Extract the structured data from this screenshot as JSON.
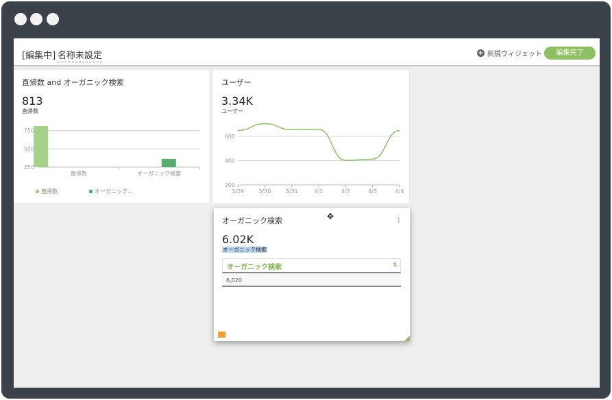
{
  "toolbar": {
    "mode_label": "[編集中]",
    "dashboard_title": "名称未設定",
    "new_widget_label": "新規ウィジェット",
    "done_label": "編集完了"
  },
  "widgets": [
    {
      "title": "直帰数 and オーガニック検索",
      "value": "813",
      "value_label": "直帰数",
      "legend": [
        "直帰数",
        "オーガニック..."
      ]
    },
    {
      "title": "ユーザー",
      "value": "3.34K",
      "value_label": "ユーザー"
    },
    {
      "title": "オーガニック検索",
      "value": "6.02K",
      "value_label": "オーガニック検索",
      "table": {
        "header": "オーガニック検索",
        "rows": [
          "6,020"
        ]
      }
    }
  ],
  "chart_data": [
    {
      "type": "bar",
      "categories": [
        "直帰数",
        "オーガニック検索"
      ],
      "series": [
        {
          "name": "直帰数",
          "values": [
            813,
            null
          ]
        },
        {
          "name": "オーガニック...",
          "values": [
            null,
            364
          ]
        }
      ],
      "yticks": [
        250,
        500,
        750
      ],
      "ylim": [
        250,
        813
      ],
      "colors": [
        "#a6d18a",
        "#5aad6c"
      ]
    },
    {
      "type": "line",
      "x": [
        "3/29",
        "3/30",
        "3/31",
        "4/1",
        "4/2",
        "4/3",
        "4/4"
      ],
      "values": [
        648,
        704,
        654,
        657,
        402,
        412,
        648
      ],
      "yticks": [
        200,
        400,
        600
      ],
      "ylim": [
        200,
        600
      ],
      "color": "#8cc063"
    }
  ]
}
